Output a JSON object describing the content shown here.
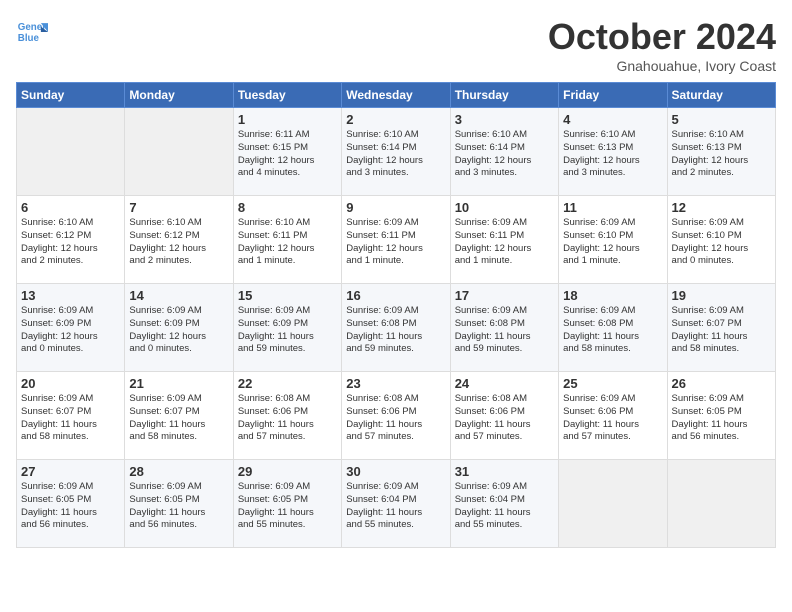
{
  "logo": {
    "line1": "General",
    "line2": "Blue"
  },
  "title": "October 2024",
  "location": "Gnahouahue, Ivory Coast",
  "weekdays": [
    "Sunday",
    "Monday",
    "Tuesday",
    "Wednesday",
    "Thursday",
    "Friday",
    "Saturday"
  ],
  "weeks": [
    [
      {
        "day": "",
        "info": ""
      },
      {
        "day": "",
        "info": ""
      },
      {
        "day": "1",
        "info": "Sunrise: 6:11 AM\nSunset: 6:15 PM\nDaylight: 12 hours\nand 4 minutes."
      },
      {
        "day": "2",
        "info": "Sunrise: 6:10 AM\nSunset: 6:14 PM\nDaylight: 12 hours\nand 3 minutes."
      },
      {
        "day": "3",
        "info": "Sunrise: 6:10 AM\nSunset: 6:14 PM\nDaylight: 12 hours\nand 3 minutes."
      },
      {
        "day": "4",
        "info": "Sunrise: 6:10 AM\nSunset: 6:13 PM\nDaylight: 12 hours\nand 3 minutes."
      },
      {
        "day": "5",
        "info": "Sunrise: 6:10 AM\nSunset: 6:13 PM\nDaylight: 12 hours\nand 2 minutes."
      }
    ],
    [
      {
        "day": "6",
        "info": "Sunrise: 6:10 AM\nSunset: 6:12 PM\nDaylight: 12 hours\nand 2 minutes."
      },
      {
        "day": "7",
        "info": "Sunrise: 6:10 AM\nSunset: 6:12 PM\nDaylight: 12 hours\nand 2 minutes."
      },
      {
        "day": "8",
        "info": "Sunrise: 6:10 AM\nSunset: 6:11 PM\nDaylight: 12 hours\nand 1 minute."
      },
      {
        "day": "9",
        "info": "Sunrise: 6:09 AM\nSunset: 6:11 PM\nDaylight: 12 hours\nand 1 minute."
      },
      {
        "day": "10",
        "info": "Sunrise: 6:09 AM\nSunset: 6:11 PM\nDaylight: 12 hours\nand 1 minute."
      },
      {
        "day": "11",
        "info": "Sunrise: 6:09 AM\nSunset: 6:10 PM\nDaylight: 12 hours\nand 1 minute."
      },
      {
        "day": "12",
        "info": "Sunrise: 6:09 AM\nSunset: 6:10 PM\nDaylight: 12 hours\nand 0 minutes."
      }
    ],
    [
      {
        "day": "13",
        "info": "Sunrise: 6:09 AM\nSunset: 6:09 PM\nDaylight: 12 hours\nand 0 minutes."
      },
      {
        "day": "14",
        "info": "Sunrise: 6:09 AM\nSunset: 6:09 PM\nDaylight: 12 hours\nand 0 minutes."
      },
      {
        "day": "15",
        "info": "Sunrise: 6:09 AM\nSunset: 6:09 PM\nDaylight: 11 hours\nand 59 minutes."
      },
      {
        "day": "16",
        "info": "Sunrise: 6:09 AM\nSunset: 6:08 PM\nDaylight: 11 hours\nand 59 minutes."
      },
      {
        "day": "17",
        "info": "Sunrise: 6:09 AM\nSunset: 6:08 PM\nDaylight: 11 hours\nand 59 minutes."
      },
      {
        "day": "18",
        "info": "Sunrise: 6:09 AM\nSunset: 6:08 PM\nDaylight: 11 hours\nand 58 minutes."
      },
      {
        "day": "19",
        "info": "Sunrise: 6:09 AM\nSunset: 6:07 PM\nDaylight: 11 hours\nand 58 minutes."
      }
    ],
    [
      {
        "day": "20",
        "info": "Sunrise: 6:09 AM\nSunset: 6:07 PM\nDaylight: 11 hours\nand 58 minutes."
      },
      {
        "day": "21",
        "info": "Sunrise: 6:09 AM\nSunset: 6:07 PM\nDaylight: 11 hours\nand 58 minutes."
      },
      {
        "day": "22",
        "info": "Sunrise: 6:08 AM\nSunset: 6:06 PM\nDaylight: 11 hours\nand 57 minutes."
      },
      {
        "day": "23",
        "info": "Sunrise: 6:08 AM\nSunset: 6:06 PM\nDaylight: 11 hours\nand 57 minutes."
      },
      {
        "day": "24",
        "info": "Sunrise: 6:08 AM\nSunset: 6:06 PM\nDaylight: 11 hours\nand 57 minutes."
      },
      {
        "day": "25",
        "info": "Sunrise: 6:09 AM\nSunset: 6:06 PM\nDaylight: 11 hours\nand 57 minutes."
      },
      {
        "day": "26",
        "info": "Sunrise: 6:09 AM\nSunset: 6:05 PM\nDaylight: 11 hours\nand 56 minutes."
      }
    ],
    [
      {
        "day": "27",
        "info": "Sunrise: 6:09 AM\nSunset: 6:05 PM\nDaylight: 11 hours\nand 56 minutes."
      },
      {
        "day": "28",
        "info": "Sunrise: 6:09 AM\nSunset: 6:05 PM\nDaylight: 11 hours\nand 56 minutes."
      },
      {
        "day": "29",
        "info": "Sunrise: 6:09 AM\nSunset: 6:05 PM\nDaylight: 11 hours\nand 55 minutes."
      },
      {
        "day": "30",
        "info": "Sunrise: 6:09 AM\nSunset: 6:04 PM\nDaylight: 11 hours\nand 55 minutes."
      },
      {
        "day": "31",
        "info": "Sunrise: 6:09 AM\nSunset: 6:04 PM\nDaylight: 11 hours\nand 55 minutes."
      },
      {
        "day": "",
        "info": ""
      },
      {
        "day": "",
        "info": ""
      }
    ]
  ]
}
